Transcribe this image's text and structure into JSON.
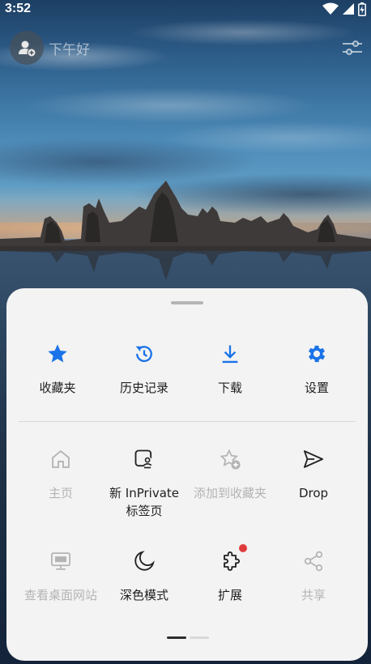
{
  "status_bar": {
    "time": "3:52"
  },
  "header": {
    "greeting": "下午好"
  },
  "menu": {
    "row1": [
      {
        "label": "收藏夹",
        "icon": "star-icon"
      },
      {
        "label": "历史记录",
        "icon": "history-icon"
      },
      {
        "label": "下载",
        "icon": "download-icon"
      },
      {
        "label": "设置",
        "icon": "gear-icon"
      }
    ],
    "row2": [
      {
        "label": "主页",
        "icon": "home-icon",
        "disabled": true
      },
      {
        "label_line1": "新 InPrivate",
        "label_line2": "标签页",
        "icon": "inprivate-tab-icon"
      },
      {
        "label": "添加到收藏夹",
        "icon": "add-favorite-icon",
        "disabled": true
      },
      {
        "label": "Drop",
        "icon": "send-icon"
      }
    ],
    "row3": [
      {
        "label": "查看桌面网站",
        "icon": "desktop-site-icon",
        "disabled": true
      },
      {
        "label": "深色模式",
        "icon": "moon-icon"
      },
      {
        "label": "扩展",
        "icon": "puzzle-icon"
      },
      {
        "label": "共享",
        "icon": "share-icon",
        "disabled": true
      }
    ]
  },
  "colors": {
    "accent": "#1a73e8",
    "sheet_bg": "#f3f3f3",
    "badge": "#e03b3b"
  }
}
